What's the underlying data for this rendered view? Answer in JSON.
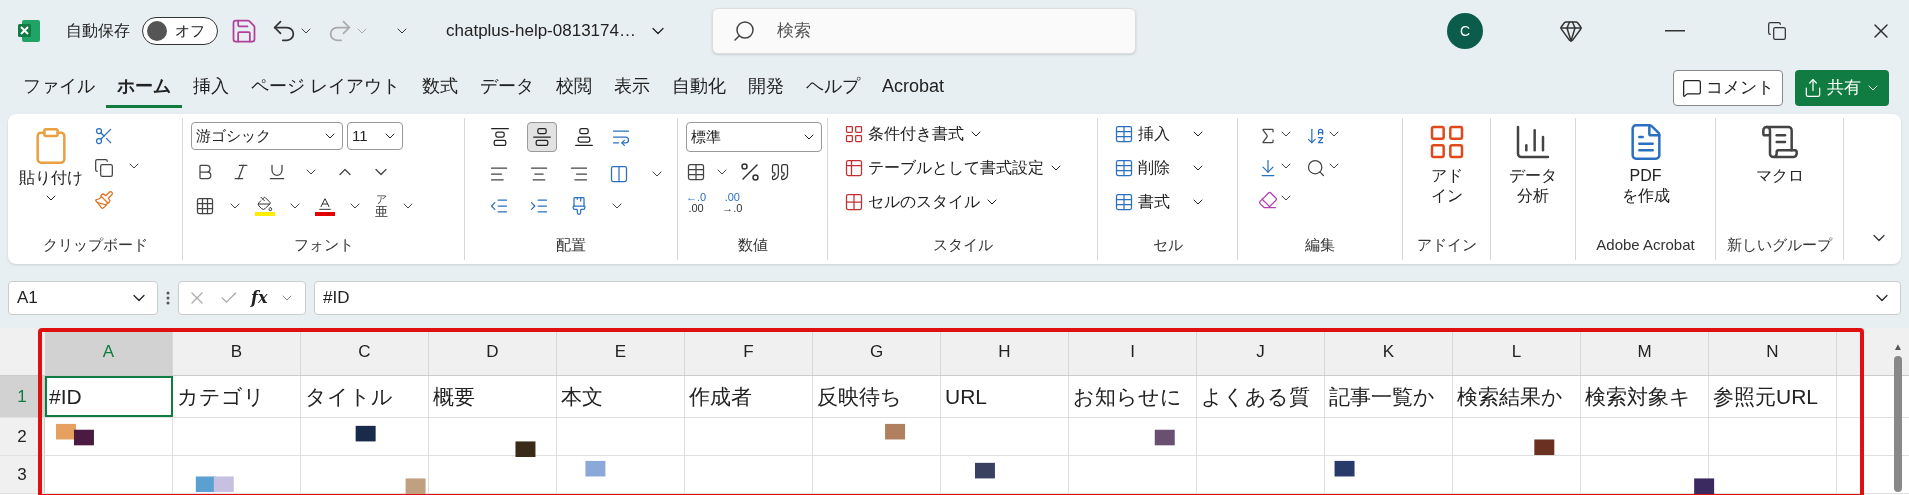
{
  "title_bar": {
    "autosave_label": "自動保存",
    "autosave": {
      "label": "オフ",
      "on": false
    },
    "file_name": "chatplus-help-0813174…",
    "search": {
      "placeholder": "検索"
    },
    "account_initial": "C"
  },
  "menu_tabs": [
    {
      "label": "ファイル",
      "selected": false
    },
    {
      "label": "ホーム",
      "selected": true
    },
    {
      "label": "挿入",
      "selected": false
    },
    {
      "label": "ページ レイアウト",
      "selected": false
    },
    {
      "label": "数式",
      "selected": false
    },
    {
      "label": "データ",
      "selected": false
    },
    {
      "label": "校閲",
      "selected": false
    },
    {
      "label": "表示",
      "selected": false
    },
    {
      "label": "自動化",
      "selected": false
    },
    {
      "label": "開発",
      "selected": false
    },
    {
      "label": "ヘルプ",
      "selected": false
    },
    {
      "label": "Acrobat",
      "selected": false
    }
  ],
  "comment_button": "コメント",
  "share_button": "共有",
  "ribbon": {
    "clipboard": {
      "paste": "貼り付け",
      "label": "クリップボード"
    },
    "font": {
      "font_name": "游ゴシック",
      "font_size": "11",
      "phonetic_top": "ア",
      "phonetic_bottom": "亜",
      "label": "フォント"
    },
    "alignment": {
      "vertical": [
        {
          "kind": "top",
          "selected": false
        },
        {
          "kind": "middle",
          "selected": true
        },
        {
          "kind": "bottom",
          "selected": false
        }
      ],
      "label": "配置"
    },
    "number": {
      "format": "標準",
      "increase_decimal": [
        "←.0",
        ".00"
      ],
      "decrease_decimal": [
        ".00",
        "→.0"
      ],
      "label": "数値"
    },
    "styles": {
      "items": [
        "条件付き書式",
        "テーブルとして書式設定",
        "セルのスタイル"
      ],
      "label": "スタイル"
    },
    "cells": {
      "items": [
        "挿入",
        "削除",
        "書式"
      ],
      "label": "セル"
    },
    "editing": {
      "label": "編集"
    },
    "addins": {
      "button": [
        "アド",
        "イン"
      ],
      "label": "アドイン"
    },
    "data_analysis": {
      "button": [
        "データ",
        "分析"
      ]
    },
    "acrobat": {
      "button": [
        "PDF",
        "を作成"
      ],
      "label": "Adobe Acrobat"
    },
    "custom": {
      "button": "マクロ",
      "label": "新しいグループ"
    }
  },
  "formula_bar": {
    "name_box": "A1",
    "function_label": "fx",
    "formula": "#ID"
  },
  "scroll_up": "▲",
  "sheet": {
    "columns": [
      {
        "label": "A",
        "selected": true
      },
      {
        "label": "B",
        "selected": false
      },
      {
        "label": "C",
        "selected": false
      },
      {
        "label": "D",
        "selected": false
      },
      {
        "label": "E",
        "selected": false
      },
      {
        "label": "F",
        "selected": false
      },
      {
        "label": "G",
        "selected": false
      },
      {
        "label": "H",
        "selected": false
      },
      {
        "label": "I",
        "selected": false
      },
      {
        "label": "J",
        "selected": false
      },
      {
        "label": "K",
        "selected": false
      },
      {
        "label": "L",
        "selected": false
      },
      {
        "label": "M",
        "selected": false
      },
      {
        "label": "N",
        "selected": false
      }
    ],
    "rows": [
      {
        "number": "1",
        "selected": true,
        "cells": [
          "#ID",
          "カテゴリ",
          "タイトル",
          "概要",
          "本文",
          "作成者",
          "反映待ち",
          "URL",
          "お知らせに",
          "よくある質",
          "記事一覧か",
          "検索結果か",
          "検索対象キ",
          "参照元URL"
        ]
      },
      {
        "number": "2",
        "selected": false
      },
      {
        "number": "3",
        "selected": false
      }
    ]
  }
}
